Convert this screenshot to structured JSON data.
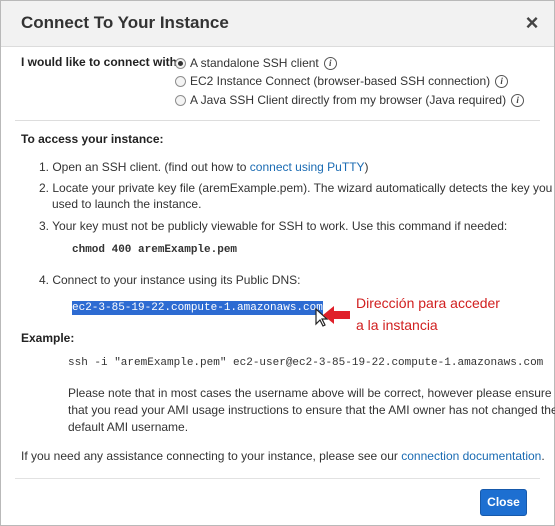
{
  "dialog": {
    "title": "Connect To Your Instance",
    "close_icon": "×"
  },
  "connect_with": {
    "label": "I would like to connect with",
    "options": [
      {
        "label": "A standalone SSH client",
        "checked": true
      },
      {
        "label": "EC2 Instance Connect (browser-based SSH connection)",
        "checked": false
      },
      {
        "label": "A Java SSH Client directly from my browser (Java required)",
        "checked": false
      }
    ],
    "info_icon": "i"
  },
  "access": {
    "heading": "To access your instance:",
    "step1_prefix": "1. Open an SSH client. (find out how to",
    "step1_link": "connect using PuTTY",
    "step1_suffix": ")",
    "step2_line1": "2. Locate your private key file (aremExample.pem). The wizard automatically detects the key you",
    "step2_line2": "used to launch the instance.",
    "step3": "3. Your key must not be publicly viewable for SSH to work. Use this command if needed:",
    "chmod_command": "chmod 400 aremExample.pem",
    "step4": "4. Connect to your instance using its Public DNS:",
    "public_dns": "ec2-3-85-19-22.compute-1.amazonaws.com"
  },
  "annotation": {
    "line1": "Dirección para acceder",
    "line2": "a la instancia",
    "color": "#d12020"
  },
  "example": {
    "heading": "Example:",
    "ssh_command": "ssh -i \"aremExample.pem\" ec2-user@ec2-3-85-19-22.compute-1.amazonaws.com",
    "note_line1": "Please note that in most cases the username above will be correct, however please ensure",
    "note_line2": "that you read your AMI usage instructions to ensure that the AMI owner has not changed the",
    "note_line3": "default AMI username."
  },
  "assistance": {
    "prefix": "If you need any assistance connecting to your instance, please see our",
    "link": "connection documentation",
    "suffix": "."
  },
  "footer": {
    "close_label": "Close"
  },
  "colors": {
    "accent": "#1d6fd1",
    "link": "#1a6bb3",
    "selection": "#2d6bd2"
  }
}
